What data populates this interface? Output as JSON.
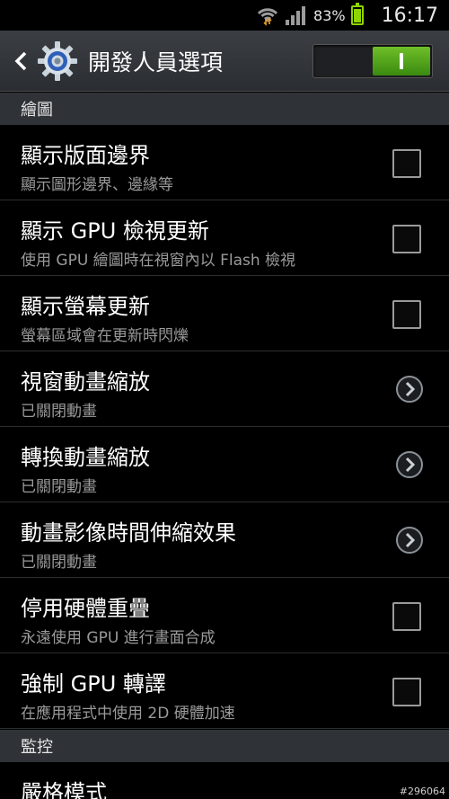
{
  "status": {
    "wifi_icon": "wifi-icon",
    "signal_icon": "signal-icon",
    "battery_pct": "83%",
    "battery_level": 0.83,
    "time": "16:17"
  },
  "action_bar": {
    "back_icon": "chevron-left-icon",
    "app_icon": "gear-icon",
    "title": "開發人員選項",
    "toggle_on": true
  },
  "sections": {
    "drawing": "繪圖",
    "monitoring": "監控"
  },
  "items": [
    {
      "title": "顯示版面邊界",
      "summary": "顯示圖形邊界、邊緣等",
      "control": "checkbox",
      "checked": false
    },
    {
      "title": "顯示 GPU 檢視更新",
      "summary": "使用 GPU 繪圖時在視窗內以 Flash 檢視",
      "control": "checkbox",
      "checked": false
    },
    {
      "title": "顯示螢幕更新",
      "summary": "螢幕區域會在更新時閃爍",
      "control": "checkbox",
      "checked": false
    },
    {
      "title": "視窗動畫縮放",
      "summary": "已關閉動畫",
      "control": "chevron"
    },
    {
      "title": "轉換動畫縮放",
      "summary": "已關閉動畫",
      "control": "chevron"
    },
    {
      "title": "動畫影像時間伸縮效果",
      "summary": "已關閉動畫",
      "control": "chevron"
    },
    {
      "title": "停用硬體重疊",
      "summary": "永遠使用 GPU 進行畫面合成",
      "control": "checkbox",
      "checked": false
    },
    {
      "title": "強制 GPU 轉譯",
      "summary": "在應用程式中使用 2D 硬體加速",
      "control": "checkbox",
      "checked": false
    }
  ],
  "monitoring_items": [
    {
      "title": "嚴格模式"
    }
  ],
  "watermark": "#296064",
  "colors": {
    "accent_green": "#6fbf2a",
    "battery_green": "#8fd400",
    "section_bg": "#2f3337"
  }
}
